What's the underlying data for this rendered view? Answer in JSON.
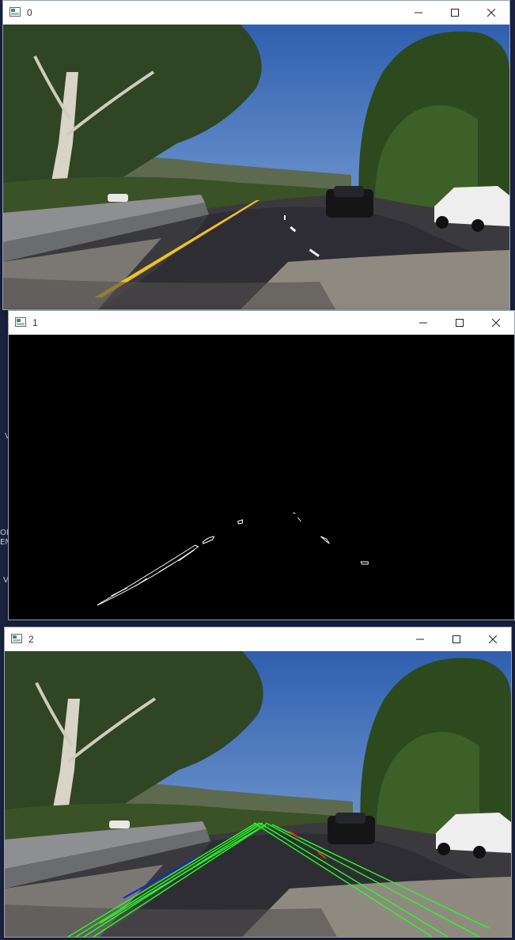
{
  "windows": [
    {
      "title": "0"
    },
    {
      "title": "1"
    },
    {
      "title": "2"
    }
  ],
  "desktop": {
    "fragments": [
      "V",
      "OB",
      "EM",
      "V"
    ]
  },
  "colors": {
    "sky": "#3f6fb8",
    "road": "#2e2d33",
    "edge_white": "#ffffff",
    "lane_yellow": "#f2c21b",
    "hough_green": "#22ff22",
    "hough_blue": "#1424d8",
    "hough_red": "#e0301a"
  },
  "icons": {
    "app": "opencv-window-icon",
    "minimize": "minimize-icon",
    "maximize": "maximize-icon",
    "close": "close-icon"
  }
}
